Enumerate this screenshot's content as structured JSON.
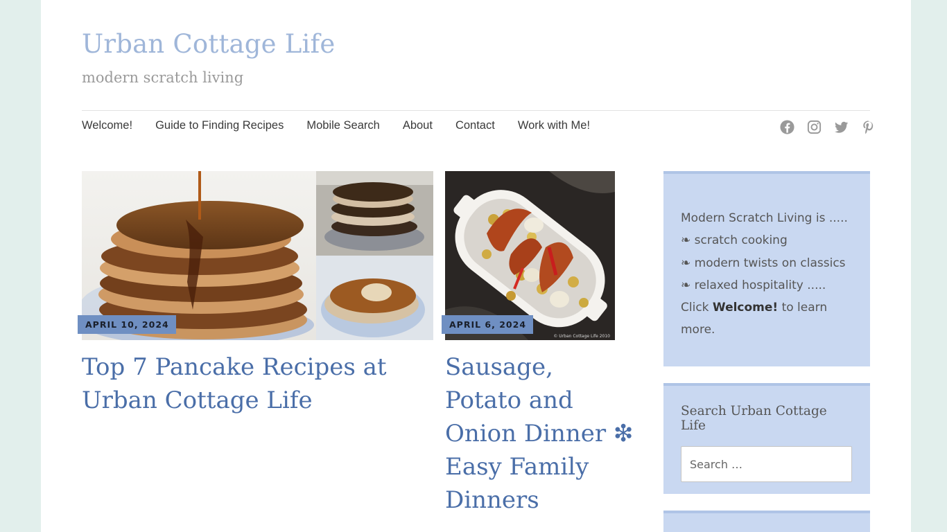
{
  "site": {
    "title": "Urban Cottage Life",
    "tagline": "modern scratch living"
  },
  "nav": {
    "items": [
      "Welcome!",
      "Guide to Finding Recipes",
      "Mobile Search",
      "About",
      "Contact",
      "Work with Me!"
    ]
  },
  "social": {
    "icons": [
      "facebook-icon",
      "instagram-icon",
      "twitter-icon",
      "pinterest-icon"
    ]
  },
  "posts": [
    {
      "date": "APRIL 10, 2024",
      "title": "Top 7 Pancake Recipes at Urban Cottage Life"
    },
    {
      "date": "APRIL 6, 2024",
      "title": "Sausage, Potato and Onion Dinner ❇ Easy Family Dinners",
      "image_watermark": "© Urban Cottage Life 2010"
    }
  ],
  "sidebar": {
    "about": {
      "intro": "Modern Scratch Living is .....",
      "bullet": "❧",
      "items": [
        "scratch cooking",
        "modern twists on classics",
        "relaxed hospitality ....."
      ],
      "cta_prefix": "Click ",
      "cta_link": "Welcome!",
      "cta_suffix": " to learn",
      "cta_end": "more."
    },
    "search": {
      "heading": "Search Urban Cottage Life",
      "placeholder": "Search …"
    }
  },
  "colors": {
    "background": "#e2efec",
    "title": "#9fb6d9",
    "post_title": "#4a6ea8",
    "badge": "#6f8fc2",
    "widget": "#c9d8f1"
  }
}
